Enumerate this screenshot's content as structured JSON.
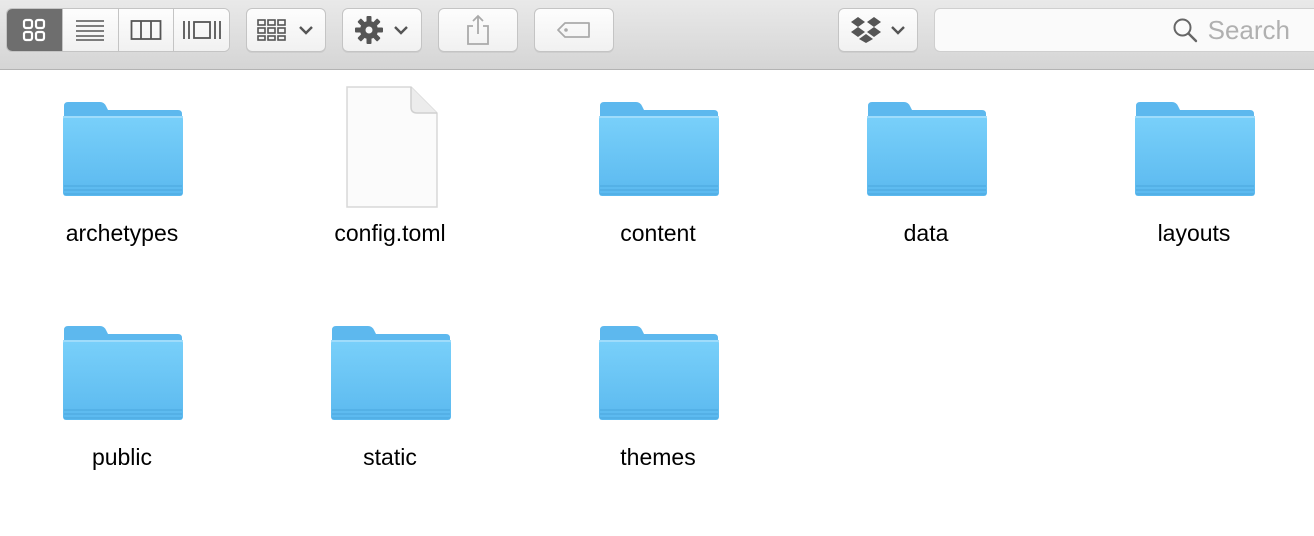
{
  "toolbar": {
    "view_buttons": [
      "icon-view",
      "list-view",
      "column-view",
      "coverflow-view"
    ],
    "active_view": "icon-view",
    "arrange_icon": "arrange-grid-icon",
    "action_icon": "gear-icon",
    "share_icon": "share-icon",
    "tag_icon": "tag-icon",
    "dropbox_icon": "dropbox-icon"
  },
  "search": {
    "placeholder": "Search"
  },
  "items": [
    {
      "name": "archetypes",
      "kind": "folder"
    },
    {
      "name": "config.toml",
      "kind": "file"
    },
    {
      "name": "content",
      "kind": "folder"
    },
    {
      "name": "data",
      "kind": "folder"
    },
    {
      "name": "layouts",
      "kind": "folder"
    },
    {
      "name": "public",
      "kind": "folder"
    },
    {
      "name": "static",
      "kind": "folder"
    },
    {
      "name": "themes",
      "kind": "folder"
    }
  ],
  "colors": {
    "folder": "#6cc6f5",
    "active_segment": "#6e6e6e"
  }
}
